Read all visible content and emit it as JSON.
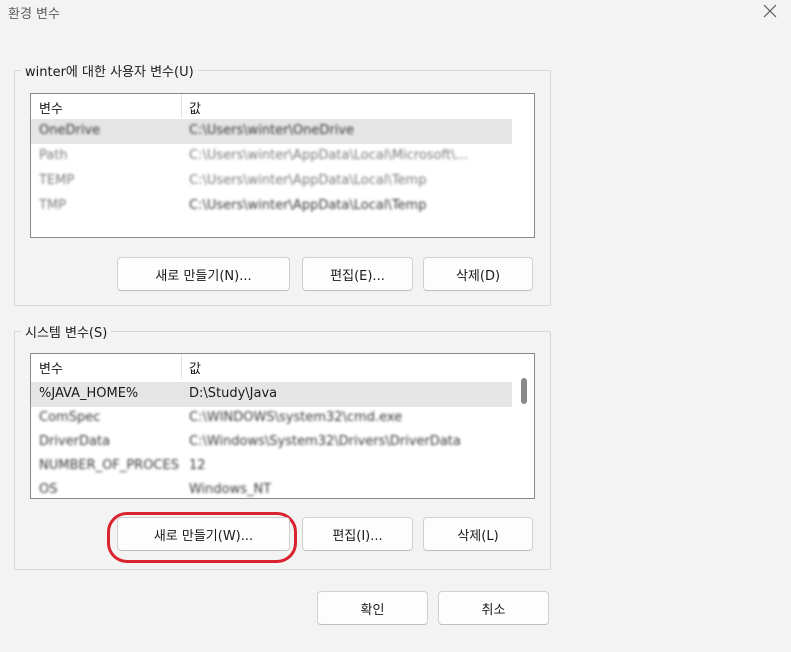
{
  "window": {
    "title": "환경 변수",
    "close_icon": "close-icon"
  },
  "user_vars": {
    "group_label": "winter에 대한 사용자 변수(U)",
    "columns": [
      "변수",
      "값"
    ],
    "rows": [
      {
        "name": "OneDrive",
        "value": "C:\\Users\\winter\\OneDrive",
        "selected": true
      },
      {
        "name": "Path",
        "value": "C:\\Users\\winter\\AppData\\Local\\Microsoft\\...",
        "selected": false
      },
      {
        "name": "TEMP",
        "value": "C:\\Users\\winter\\AppData\\Local\\Temp",
        "selected": false
      },
      {
        "name": "TMP",
        "value": "C:\\Users\\winter\\AppData\\Local\\Temp",
        "selected": false
      }
    ],
    "buttons": {
      "new": "새로 만들기(N)...",
      "edit": "편집(E)...",
      "delete": "삭제(D)"
    }
  },
  "system_vars": {
    "group_label": "시스템 변수(S)",
    "columns": [
      "변수",
      "값"
    ],
    "rows": [
      {
        "name": "%JAVA_HOME%",
        "value": "D:\\Study\\Java",
        "selected": true
      },
      {
        "name": "ComSpec",
        "value": "C:\\WINDOWS\\system32\\cmd.exe",
        "selected": false
      },
      {
        "name": "DriverData",
        "value": "C:\\Windows\\System32\\Drivers\\DriverData",
        "selected": false
      },
      {
        "name": "NUMBER_OF_PROCESSORS",
        "value": "12",
        "selected": false
      },
      {
        "name": "OS",
        "value": "Windows_NT",
        "selected": false
      }
    ],
    "buttons": {
      "new": "새로 만들기(W)...",
      "edit": "편집(I)...",
      "delete": "삭제(L)"
    }
  },
  "footer": {
    "ok": "확인",
    "cancel": "취소"
  },
  "colors": {
    "highlight": "#d9232f",
    "background": "#f3f3f3"
  }
}
